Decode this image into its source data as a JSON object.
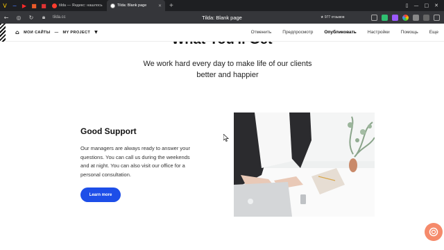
{
  "browser": {
    "tabs": [
      {
        "label": "tilda — Яндекс: нашлось",
        "favicon_color": "#ff3d2e",
        "active": false
      },
      {
        "label": "Tilda: Blank page",
        "favicon_color": "#e0e0e0",
        "active": true
      }
    ],
    "new_tab_label": "+",
    "url": "tilda.cc",
    "page_title": "Tilda: Blank page",
    "reviews_label": "★ 977 отзывов"
  },
  "tilda_bar": {
    "breadcrumb_sites": "МОИ САЙТЫ",
    "breadcrumb_separator": "—",
    "breadcrumb_project": "MY PROJECT",
    "menu": [
      {
        "label": "Отменить"
      },
      {
        "label": "Предпросмотр"
      },
      {
        "label": "Опубликовать"
      },
      {
        "label": "Настройки"
      },
      {
        "label": "Помощь"
      },
      {
        "label": "Еще"
      }
    ]
  },
  "page": {
    "heading": "What You'll Get",
    "lead": "We work hard every day to make life of our clients better and happier",
    "support_title": "Good Support",
    "support_text": "Our managers are always ready to answer your questions. You can call us during the weekends and at night. You can also visit our office for a personal consultation.",
    "button_label": "Learn more"
  },
  "colors": {
    "accent_button": "#1d4ee8",
    "help_button": "#f58a6b",
    "browser_chrome": "#35363a"
  }
}
